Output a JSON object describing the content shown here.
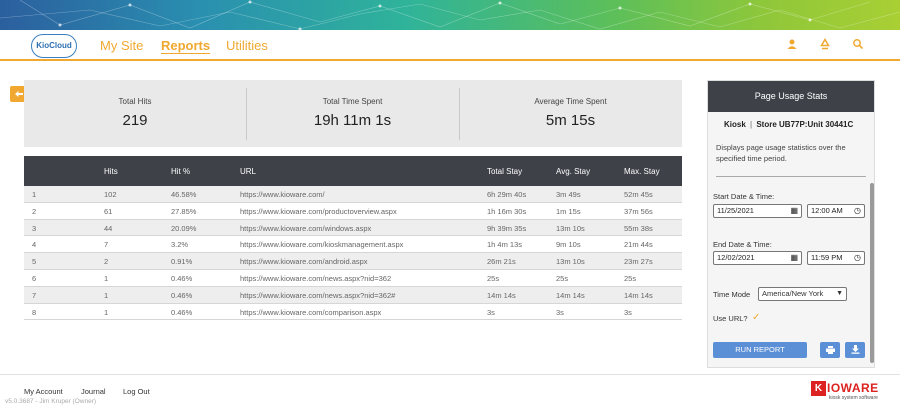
{
  "header": {
    "logo_text": "KioCloud",
    "nav": [
      {
        "label": "My Site"
      },
      {
        "label": "Reports"
      },
      {
        "label": "Utilities"
      }
    ],
    "icons": [
      "user-icon",
      "recycle-icon",
      "search-icon"
    ]
  },
  "stats": {
    "total_hits_label": "Total Hits",
    "total_hits_value": "219",
    "total_time_label": "Total Time Spent",
    "total_time_value": "19h 11m 1s",
    "avg_time_label": "Average Time Spent",
    "avg_time_value": "5m 15s"
  },
  "table": {
    "headers": {
      "hits": "Hits",
      "hit_pct": "Hit %",
      "url": "URL",
      "total_stay": "Total Stay",
      "avg_stay": "Avg. Stay",
      "max_stay": "Max. Stay"
    },
    "rows": [
      {
        "n": "1",
        "hits": "102",
        "pct": "46.58%",
        "url": "https://www.kioware.com/",
        "total": "6h 29m 40s",
        "avg": "3m 49s",
        "max": "52m 45s"
      },
      {
        "n": "2",
        "hits": "61",
        "pct": "27.85%",
        "url": "https://www.kioware.com/productoverview.aspx",
        "total": "1h 16m 30s",
        "avg": "1m 15s",
        "max": "37m 56s"
      },
      {
        "n": "3",
        "hits": "44",
        "pct": "20.09%",
        "url": "https://www.kioware.com/windows.aspx",
        "total": "9h 39m 35s",
        "avg": "13m 10s",
        "max": "55m 38s"
      },
      {
        "n": "4",
        "hits": "7",
        "pct": "3.2%",
        "url": "https://www.kioware.com/kioskmanagement.aspx",
        "total": "1h 4m 13s",
        "avg": "9m 10s",
        "max": "21m 44s"
      },
      {
        "n": "5",
        "hits": "2",
        "pct": "0.91%",
        "url": "https://www.kioware.com/android.aspx",
        "total": "26m 21s",
        "avg": "13m 10s",
        "max": "23m 27s"
      },
      {
        "n": "6",
        "hits": "1",
        "pct": "0.46%",
        "url": "https://www.kioware.com/news.aspx?nid=362",
        "total": "25s",
        "avg": "25s",
        "max": "25s"
      },
      {
        "n": "7",
        "hits": "1",
        "pct": "0.46%",
        "url": "https://www.kioware.com/news.aspx?nid=362#",
        "total": "14m 14s",
        "avg": "14m 14s",
        "max": "14m 14s"
      },
      {
        "n": "8",
        "hits": "1",
        "pct": "0.46%",
        "url": "https://www.kioware.com/comparison.aspx",
        "total": "3s",
        "avg": "3s",
        "max": "3s"
      }
    ]
  },
  "panel": {
    "title": "Page Usage Stats",
    "kiosk_label": "Kiosk",
    "kiosk_sep": "|",
    "kiosk_name": "Store UB77P:Unit 30441C",
    "description": "Displays page usage statistics over the specified time period.",
    "start_label": "Start Date & Time:",
    "start_date": "11/25/2021",
    "start_time": "12:00 AM",
    "end_label": "End Date & Time:",
    "end_date": "12/02/2021",
    "end_time": "11:59 PM",
    "time_mode_label": "Time Mode",
    "time_mode_value": "America/New York",
    "use_url_label": "Use URL?",
    "run_button": "RUN REPORT"
  },
  "footer": {
    "links": [
      "My Account",
      "Journal",
      "Log Out"
    ],
    "version": "v5.0.3687 - Jim Kruper (Owner)",
    "brand_word": "IOWARE",
    "brand_k": "K",
    "brand_tag": "kiosk system software"
  },
  "colors": {
    "accent": "#f0a830",
    "dark": "#3e4148",
    "button": "#5b8fd6",
    "brand": "#d22222"
  }
}
